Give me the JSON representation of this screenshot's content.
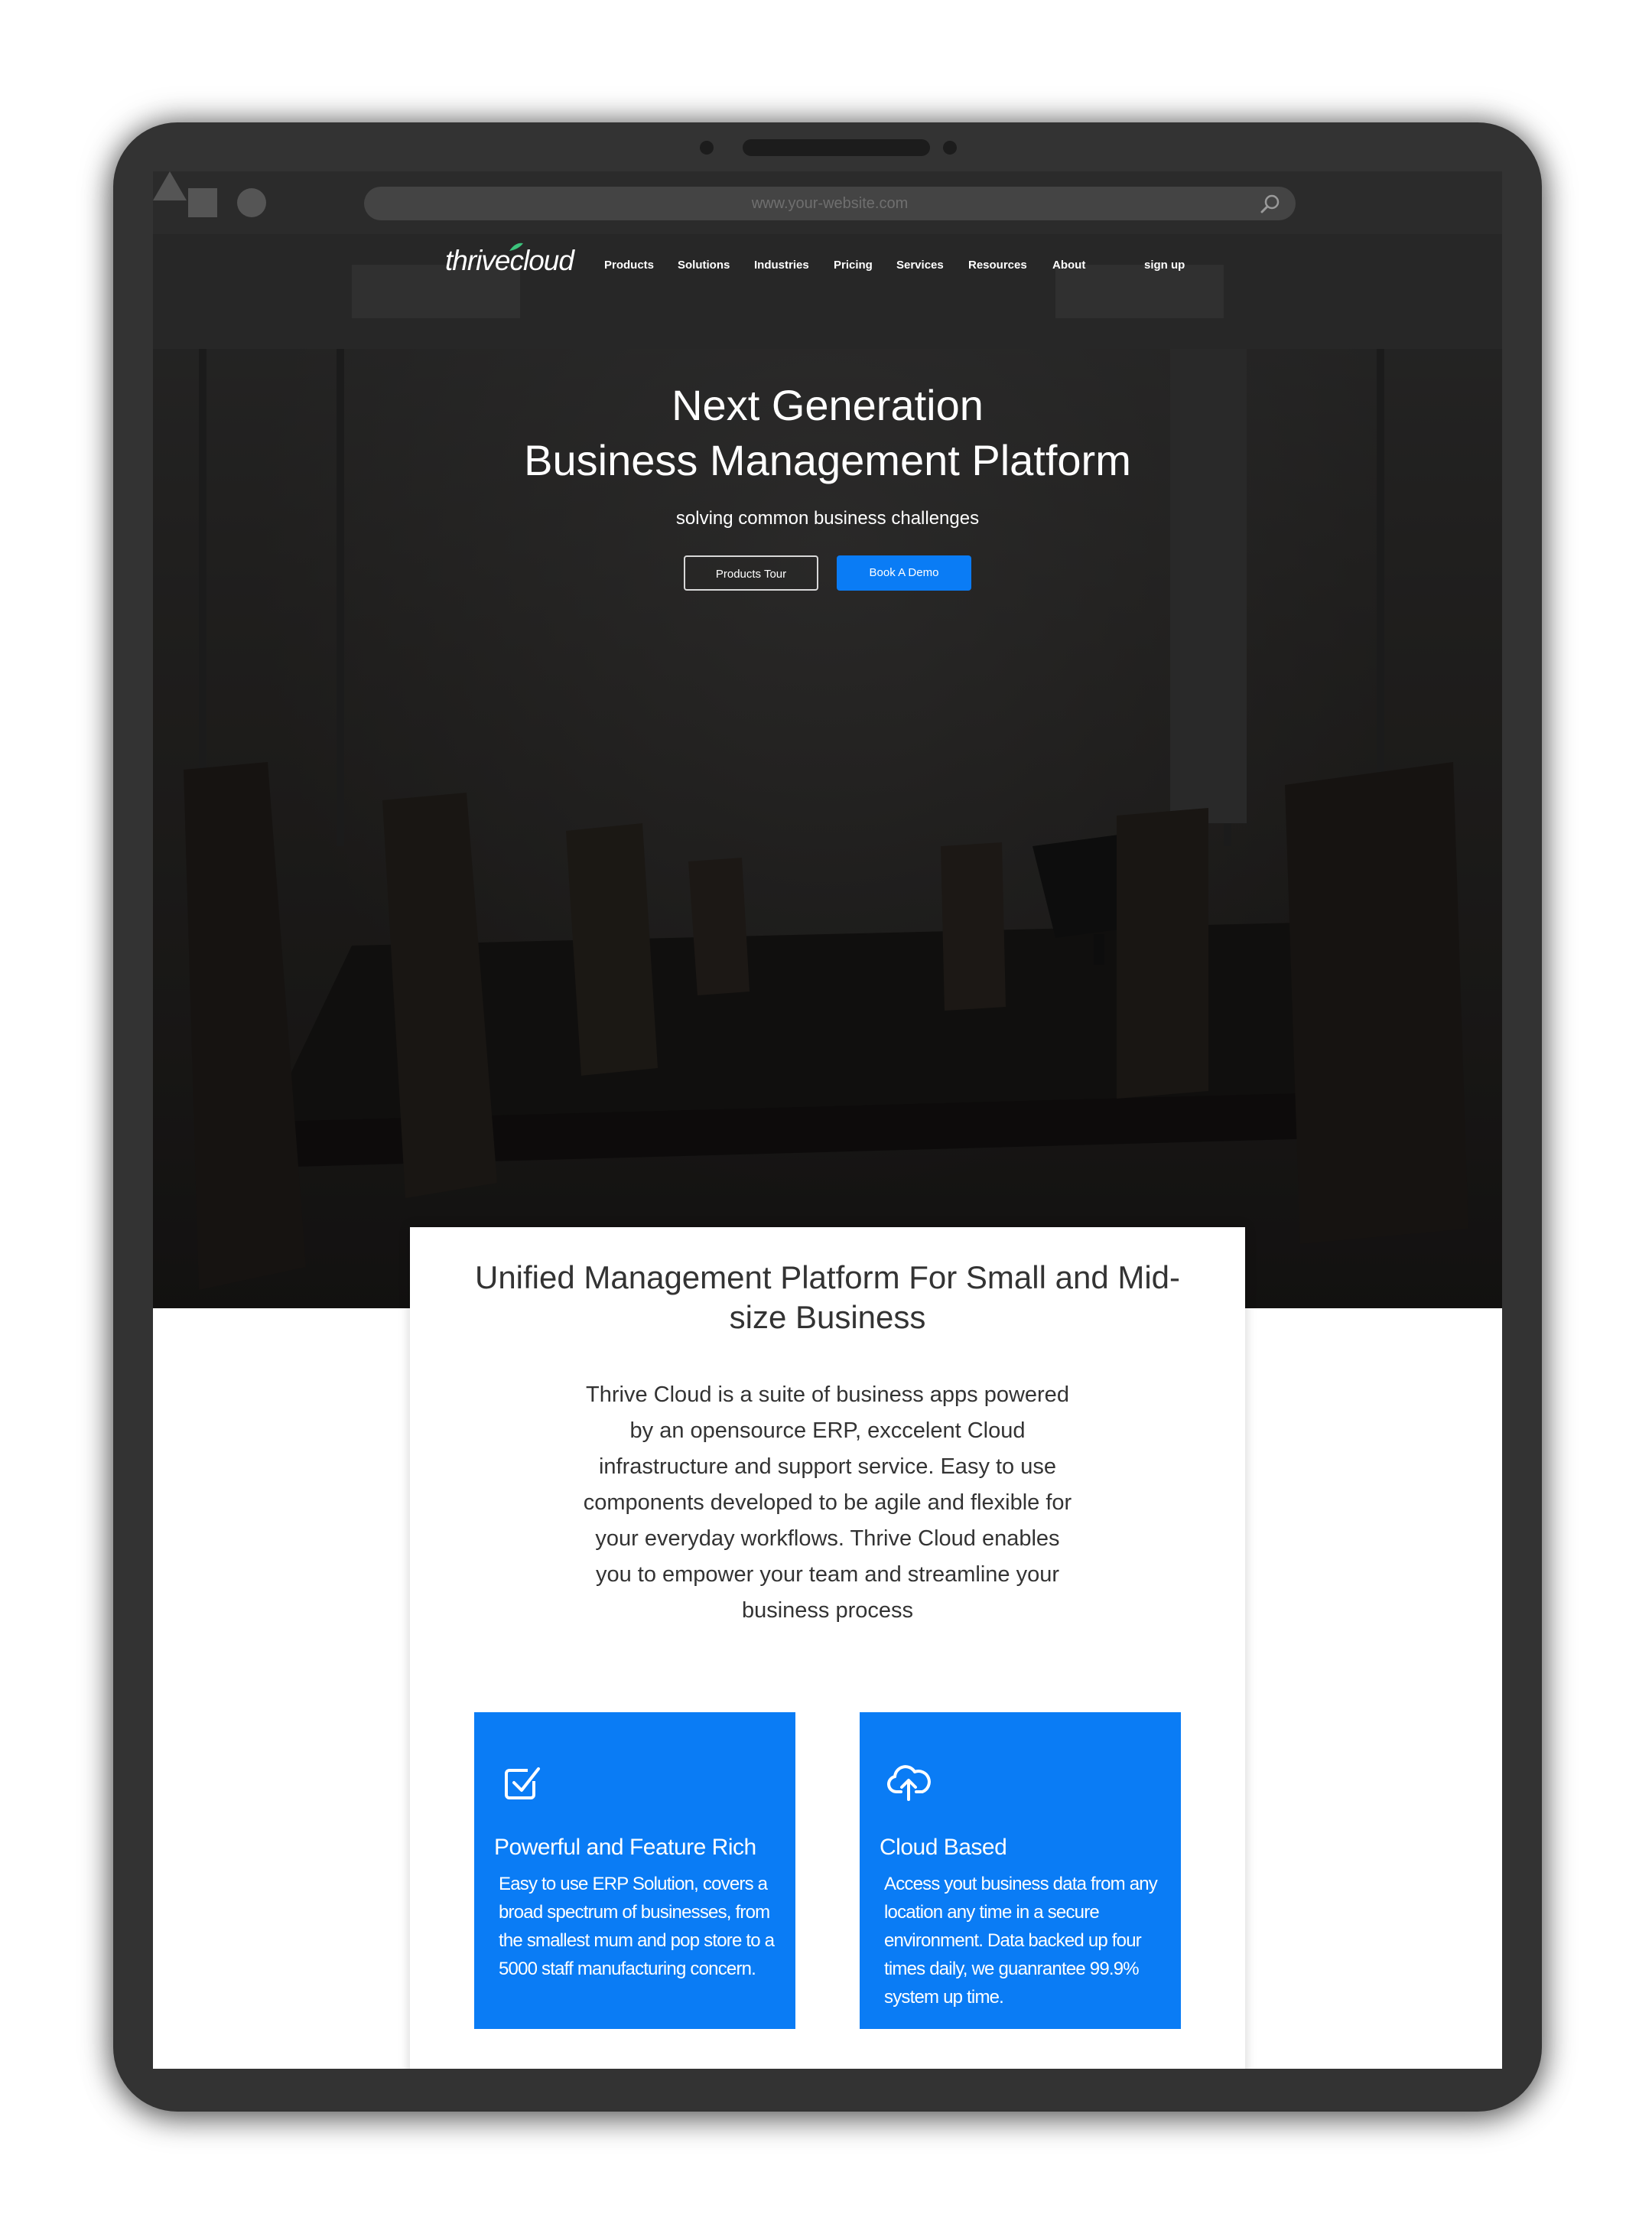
{
  "browser": {
    "url": "www.your-website.com",
    "search_icon": "magnifier-icon"
  },
  "nav": {
    "logo": "thrivecloud",
    "items": [
      "Products",
      "Solutions",
      "Industries",
      "Pricing",
      "Services",
      "Resources",
      "About"
    ],
    "signup": "sign up"
  },
  "hero": {
    "title_line1": "Next Generation",
    "title_line2": "Business Management Platform",
    "subtitle": "solving common business challenges",
    "tour_button": "Products Tour",
    "demo_button": "Book A Demo"
  },
  "intro": {
    "heading": "Unified Management Platform For Small and Mid-size Business",
    "body": "Thrive Cloud is a suite of business apps powered by an opensource ERP, exccelent Cloud infrastructure and support service. Easy to use components developed to be agile and flexible for your everyday workflows. Thrive Cloud enables you to empower your team and streamline your business process"
  },
  "features": [
    {
      "icon": "checkbox-icon",
      "title": "Powerful and Feature Rich",
      "text": "Easy to use ERP Solution, covers a broad spectrum of businesses, from the smallest mum and pop store to a 5000 staff manufacturing concern."
    },
    {
      "icon": "cloud-upload-icon",
      "title": "Cloud Based",
      "text": "Access yout business data from any location any time in a secure environment. Data backed up four times daily, we guanrantee 99.9% system up time."
    }
  ],
  "colors": {
    "accent": "#0a7cf5",
    "device": "#333333",
    "logo_leaf": "#3cc47c"
  }
}
